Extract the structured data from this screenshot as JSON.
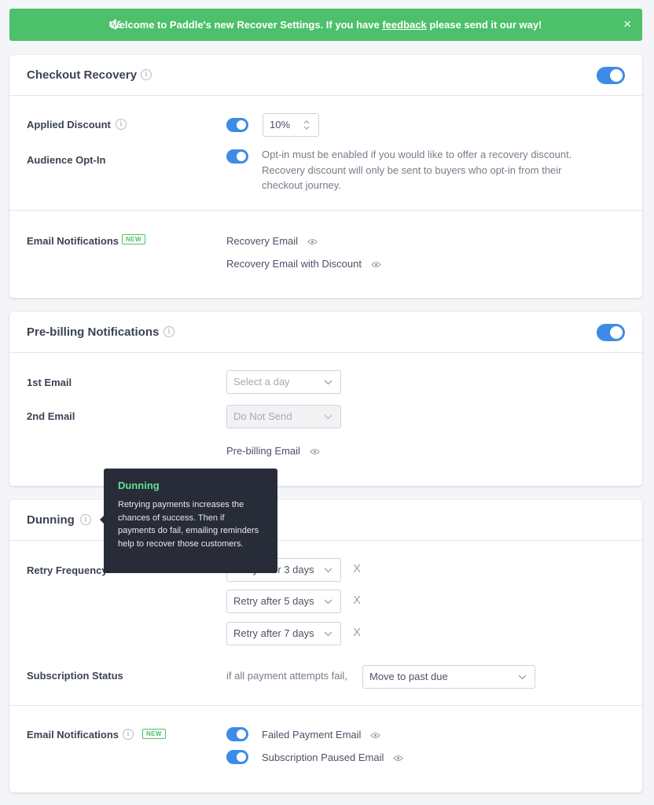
{
  "banner": {
    "text_before": "Welcome to Paddle's new Recover Settings. If you have",
    "link": "feedback",
    "text_after": "please send it our way!",
    "close": "×",
    "icon": "speaker-icon",
    "color": "#4cc06b"
  },
  "checkout_recovery": {
    "title": "Checkout Recovery",
    "enabled": true,
    "applied_discount": {
      "label": "Applied Discount",
      "enabled": true,
      "value": "10%"
    },
    "audience_opt_in": {
      "label": "Audience Opt-In",
      "enabled": true,
      "description": "Opt-in must be enabled if you would like to offer a recovery discount. Recovery discount will only be sent to buyers who opt-in from their checkout journey."
    },
    "email_notifications": {
      "label": "Email Notifications",
      "badge": "NEW",
      "items": [
        "Recovery Email",
        "Recovery Email with Discount"
      ]
    }
  },
  "prebilling": {
    "title": "Pre-billing Notifications",
    "enabled": true,
    "first_email": {
      "label": "1st Email",
      "placeholder": "Select a day"
    },
    "second_email": {
      "label": "2nd Email",
      "value": "Do Not Send"
    },
    "link": "Pre-billing Email"
  },
  "dunning": {
    "title": "Dunning",
    "tooltip": {
      "title": "Dunning",
      "body": "Retrying payments increases the chances of success. Then if payments do fail, emailing reminders help to recover those customers."
    },
    "retry_frequency": {
      "label": "Retry Frequency",
      "options": [
        "Retry after 3 days",
        "Retry after 5 days",
        "Retry after 7 days"
      ],
      "remove": "X"
    },
    "subscription_status": {
      "label": "Subscription Status",
      "prefix": "if all payment attempts fail,",
      "value": "Move to past due"
    },
    "email_notifications": {
      "label": "Email Notifications",
      "badge": "NEW",
      "items": [
        {
          "label": "Failed Payment Email",
          "enabled": true
        },
        {
          "label": "Subscription Paused Email",
          "enabled": true
        }
      ]
    }
  },
  "colors": {
    "accent": "#3d8be6",
    "success": "#4cc06b",
    "tooltip_bg": "#272c38"
  }
}
